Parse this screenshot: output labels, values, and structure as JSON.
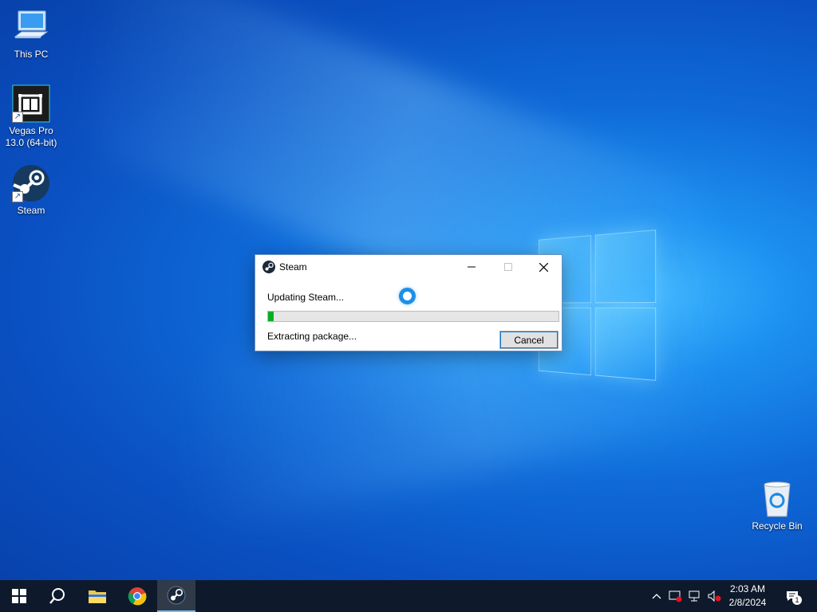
{
  "desktop": {
    "icons": [
      {
        "label": "This PC",
        "icon": "monitor-icon"
      },
      {
        "label": "Vegas Pro\n13.0 (64-bit)",
        "icon": "film-icon"
      },
      {
        "label": "Steam",
        "icon": "steam-icon"
      },
      {
        "label": "Recycle Bin",
        "icon": "recycle-bin-icon"
      }
    ]
  },
  "dialog": {
    "title": "Steam",
    "status": "Updating Steam...",
    "progress_fraction": 0.02,
    "substatus": "Extracting package...",
    "cancel_label": "Cancel"
  },
  "taskbar": {
    "apps": [
      "windows-start-icon",
      "search-icon",
      "file-explorer-icon",
      "chrome-icon",
      "steam-icon"
    ],
    "clock": {
      "time": "2:03 AM",
      "date": "2/8/2024"
    },
    "notification_count": "1"
  },
  "colors": {
    "progress": "#06b025",
    "spinner": "#1e8fe6",
    "taskbar": "#0e1a2b"
  }
}
